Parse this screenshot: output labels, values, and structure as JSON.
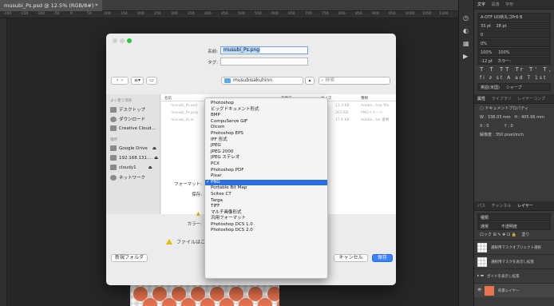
{
  "window": {
    "tab_title": "musubi_Ps.psd @ 12.5% (RGB/8#) *"
  },
  "ruler": {
    "ticks": [
      "-100",
      "-150",
      "-100",
      "-50",
      "0",
      "50",
      "100",
      "150",
      "200",
      "250",
      "300",
      "350",
      "400",
      "450",
      "500",
      "550",
      "600",
      "650",
      "700",
      "750",
      "800",
      "850",
      "900",
      "950",
      "1000",
      "1050",
      "1100"
    ]
  },
  "dialog": {
    "name_label": "名前:",
    "name_value": "musubi_Ps.png",
    "tag_label": "タグ:",
    "folder_name": "musubisakuhinn",
    "search_placeholder": "検索",
    "sidebar": {
      "fav_header": "よく使う項目",
      "items": [
        "デスクトップ",
        "ダウンロード",
        "Creative Cloud..."
      ],
      "loc_header": "場所",
      "locations": [
        "Google Drive",
        "192.168.131....",
        "cloudy1",
        "ネットワーク"
      ]
    },
    "columns": {
      "name": "名前",
      "modified": "変更日",
      "size": "サイズ",
      "kind": "種類"
    },
    "files": [
      {
        "name": "musubi_Ps.psd",
        "size": "11.3 KB",
        "kind": "Adobe...hop file"
      },
      {
        "name": "musubi_Ps.png",
        "size": "263 KB",
        "kind": "PNGイメージ"
      },
      {
        "name": "musubi_Ai.ai",
        "size": "17.6 KB",
        "kind": "Adobe...tor 書類"
      }
    ],
    "format_label": "フォーマット:",
    "save_label": "保存:",
    "color_label": "カラー:",
    "warning": "ファイルはこの選択範囲と共にコピーとして保存する必要があります。",
    "new_folder": "新規フォルダ",
    "cancel": "キャンセル",
    "save": "保存"
  },
  "format_menu": {
    "items": [
      "Photoshop",
      "ビッグドキュメント形式",
      "BMP",
      "CompuServe GIF",
      "Dicom",
      "Photoshop EPS",
      "IFF 形式",
      "JPEG",
      "JPEG 2000",
      "JPEG ステレオ",
      "PCX",
      "Photoshop PDF",
      "Pixar",
      "PNG",
      "Portable Bit Map",
      "Scitex CT",
      "Targa",
      "TIFF",
      "マルチ画像形式",
      "汎用フォーマット",
      "Photoshop DCS 1.0",
      "Photoshop DCS 2.0"
    ],
    "selected": "PNG",
    "checkmark": "✓"
  },
  "panel": {
    "char_tabs": [
      "文字",
      "段落",
      "字形"
    ],
    "font": "A-OTF UD新丸ゴPr6",
    "font_style": "B",
    "size": "33 pt",
    "leading": "28 pt",
    "tracking": "0",
    "kerning": "0%",
    "vscale": "100%",
    "hscale": "100%",
    "baseline": "-12 pt",
    "color_label": "カラー:",
    "lang": "英語(米国)",
    "aa": "シャープ",
    "props_tabs": [
      "属性",
      "ライブラリ",
      "レイヤーコンプ"
    ],
    "doc_props": "ドキュメントプロパティ",
    "w": "W : 338.03 mm",
    "h": "H : 405.96 mm",
    "x": "X : 0",
    "y": "Y : 0",
    "res": "解像度 : 350 pixel/inch",
    "layer_tabs": [
      "パス",
      "チャンネル",
      "レイヤー"
    ],
    "layer_kind": "種類",
    "blend": "通常",
    "opacity": "不透明度",
    "lock": "ロック",
    "fill": "塗り",
    "layers": [
      "選択用マスクオブジェクト選択",
      "選択用マスクを表示し拡張",
      "ガイドを表示し拡張",
      "背景レイヤー"
    ]
  }
}
